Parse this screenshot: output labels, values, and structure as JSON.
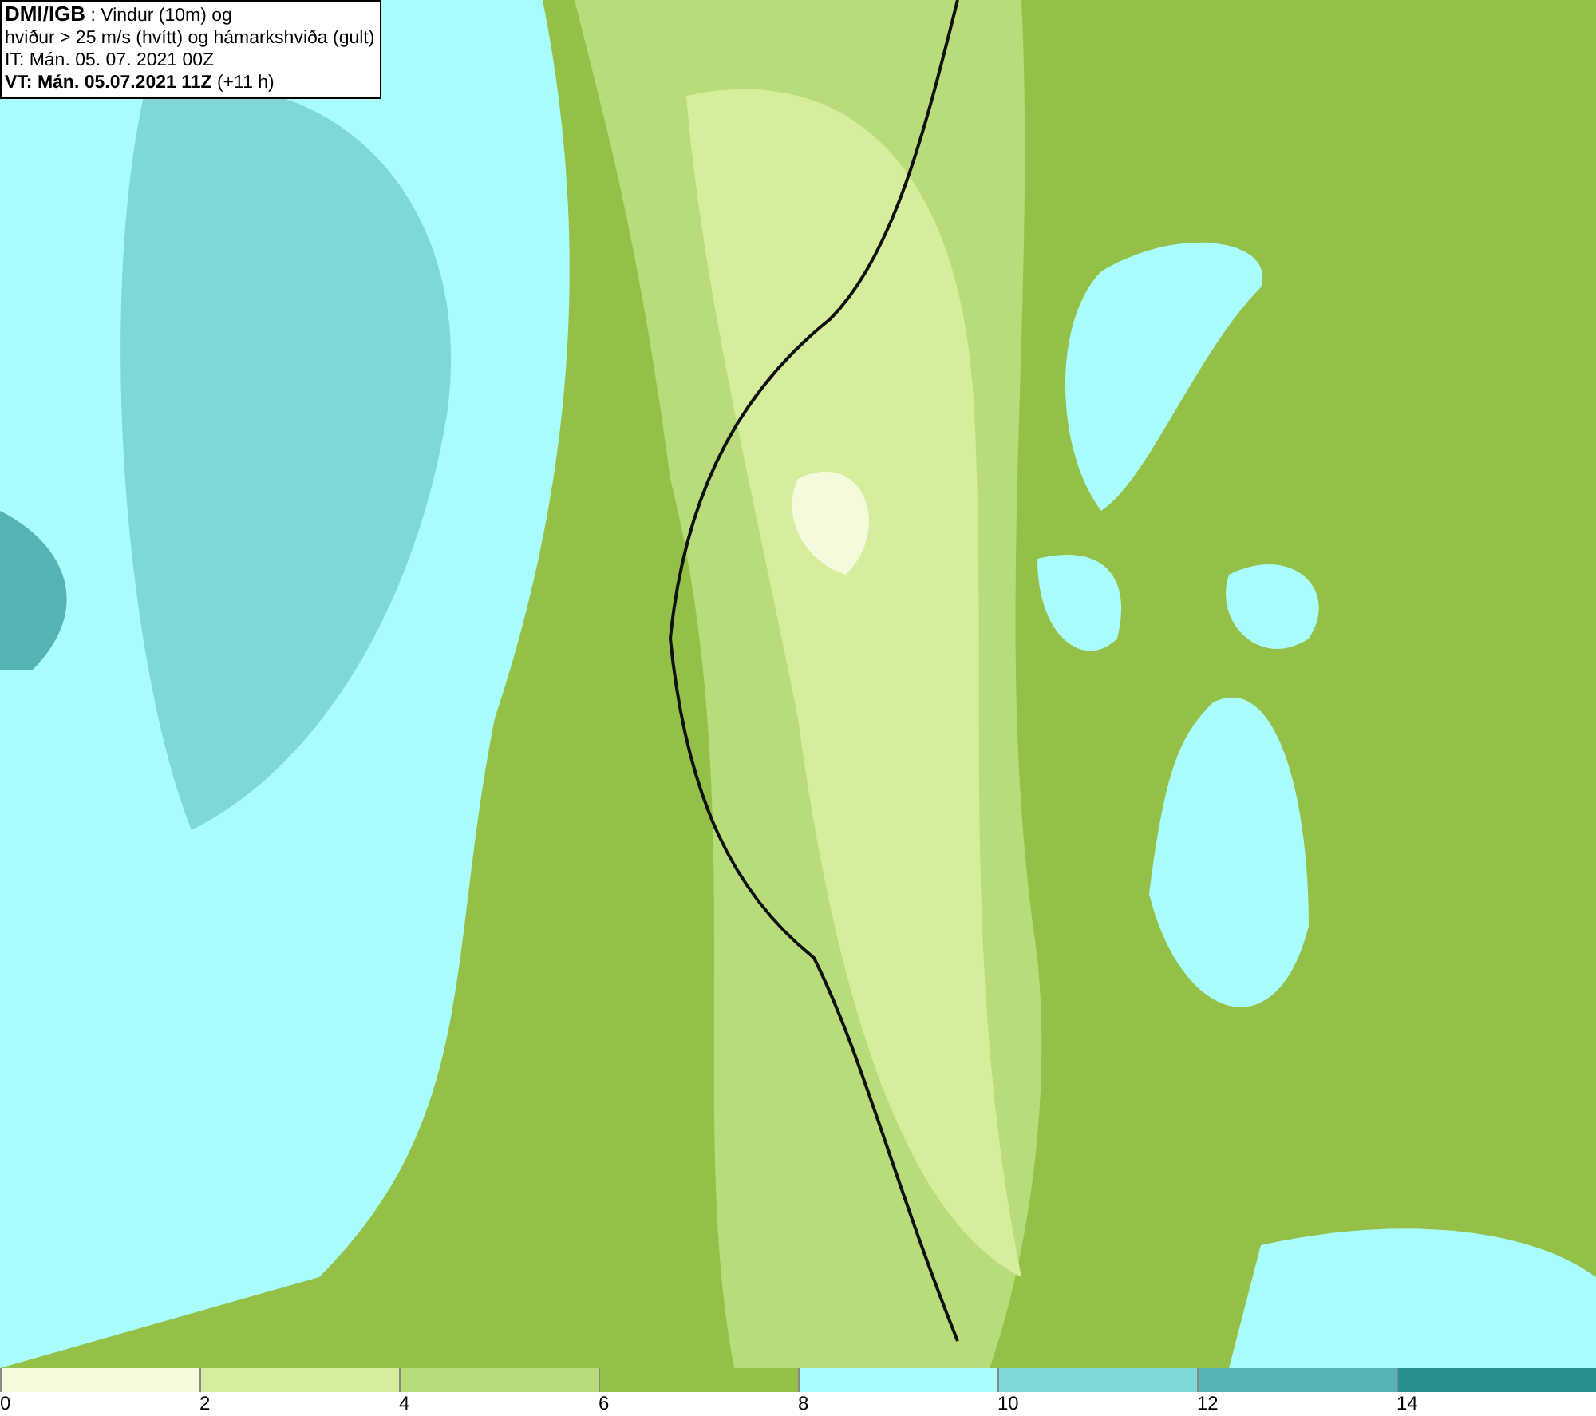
{
  "header": {
    "source": "DMI/IGB",
    "title": " : Vindur (10m) og",
    "subtitle": "hviður > 25 m/s (hvítt) og hámarkshviða (gult)",
    "issue_time": "IT: Mán. 05. 07. 2021 00Z",
    "valid_time": "VT: Mán. 05.07.2021 11Z",
    "lead": " (+11 h)"
  },
  "legend": [
    {
      "label": "0",
      "color": "#f3fbdc"
    },
    {
      "label": "2",
      "color": "#d5ee9c"
    },
    {
      "label": "4",
      "color": "#b8dc79"
    },
    {
      "label": "6",
      "color": "#94c047"
    },
    {
      "label": "8",
      "color": "#a8fcfc"
    },
    {
      "label": "10",
      "color": "#7fd8d8"
    },
    {
      "label": "12",
      "color": "#55b3b3"
    },
    {
      "label": "14",
      "color": "#2a8f8f"
    }
  ]
}
